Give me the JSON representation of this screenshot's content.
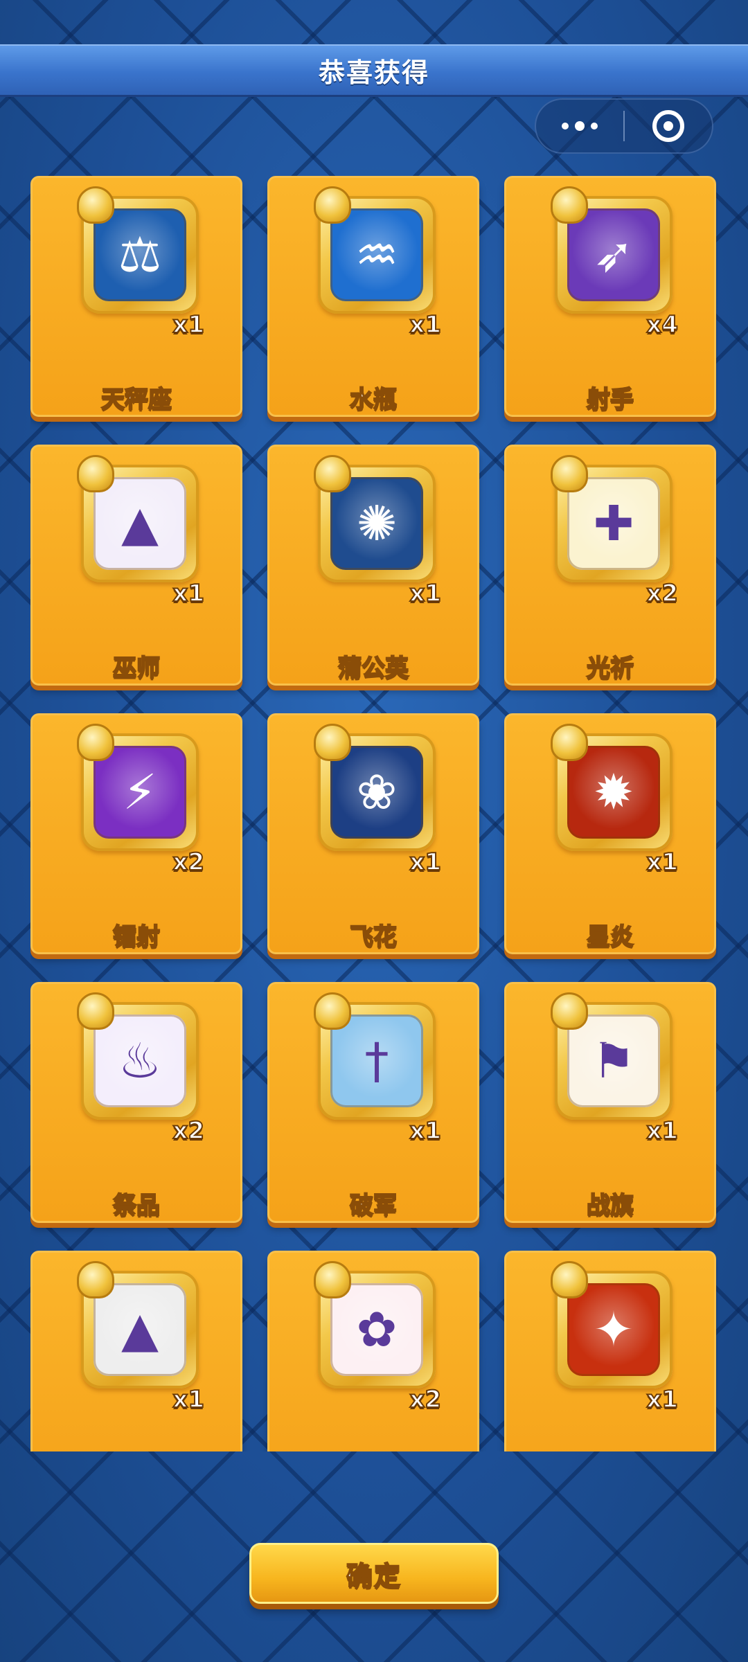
{
  "header": {
    "title": "恭喜获得"
  },
  "capsule": {
    "more_icon": "more-dots-icon",
    "close_icon": "target-circle-icon"
  },
  "rewards": [
    {
      "name": "天秤座",
      "qty": "x1",
      "icon": "libra-scale-icon",
      "color": "#1e5fb0",
      "glyph": "⚖"
    },
    {
      "name": "水瓶",
      "qty": "x1",
      "icon": "aquarius-water-icon",
      "color": "#1f6fd0",
      "glyph": "♒"
    },
    {
      "name": "射手",
      "qty": "x4",
      "icon": "archer-bow-icon",
      "color": "#6b3ab8",
      "glyph": "➶"
    },
    {
      "name": "巫师",
      "qty": "x1",
      "icon": "wizard-hat-icon",
      "color": "#f3eefa",
      "glyph": "▲"
    },
    {
      "name": "蒲公英",
      "qty": "x1",
      "icon": "dandelion-icon",
      "color": "#1f4c8f",
      "glyph": "✺"
    },
    {
      "name": "光祈",
      "qty": "x2",
      "icon": "holy-cross-icon",
      "color": "#fbf3d0",
      "glyph": "✚"
    },
    {
      "name": "镭射",
      "qty": "x2",
      "icon": "laser-beam-icon",
      "color": "#7b2fc2",
      "glyph": "⚡"
    },
    {
      "name": "飞花",
      "qty": "x1",
      "icon": "lotus-flower-icon",
      "color": "#1d3f84",
      "glyph": "❀"
    },
    {
      "name": "星炎",
      "qty": "x1",
      "icon": "star-flame-icon",
      "color": "#b7280f",
      "glyph": "✹"
    },
    {
      "name": "祭品",
      "qty": "x2",
      "icon": "altar-offering-icon",
      "color": "#f4eefc",
      "glyph": "♨"
    },
    {
      "name": "破军",
      "qty": "x1",
      "icon": "sword-break-icon",
      "color": "#8fc7ee",
      "glyph": "†"
    },
    {
      "name": "战旗",
      "qty": "x1",
      "icon": "war-banner-icon",
      "color": "#fbf4e6",
      "glyph": "⚑"
    },
    {
      "name": "",
      "qty": "x1",
      "icon": "volcano-icon",
      "color": "#eeeeee",
      "glyph": "▲"
    },
    {
      "name": "",
      "qty": "x2",
      "icon": "cherry-blossom-icon",
      "color": "#fdf0f3",
      "glyph": "✿"
    },
    {
      "name": "",
      "qty": "x1",
      "icon": "fire-dragon-icon",
      "color": "#c8300f",
      "glyph": "✦"
    }
  ],
  "footer": {
    "confirm_label": "确定"
  }
}
